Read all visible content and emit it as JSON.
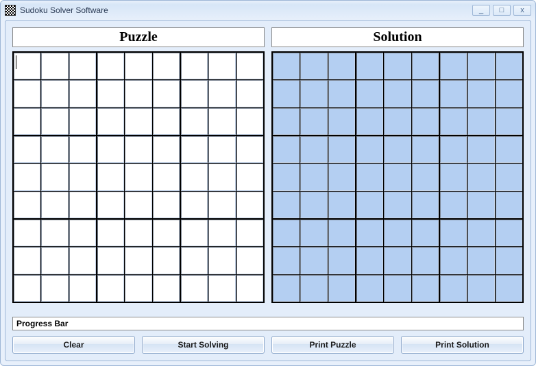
{
  "window": {
    "title": "Sudoku Solver Software"
  },
  "panels": {
    "puzzle_label": "Puzzle",
    "solution_label": "Solution"
  },
  "progress": {
    "label": "Progress Bar"
  },
  "buttons": {
    "clear": "Clear",
    "start": "Start Solving",
    "print_puzzle": "Print Puzzle",
    "print_solution": "Print Solution"
  },
  "win_controls": {
    "minimize": "_",
    "maximize": "□",
    "close": "x"
  }
}
